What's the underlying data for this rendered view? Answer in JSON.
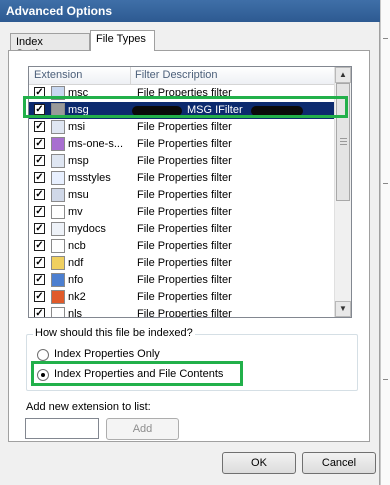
{
  "window": {
    "title": "Advanced Options"
  },
  "tabs": [
    {
      "label": "Index Settings",
      "active": false
    },
    {
      "label": "File Types",
      "active": true
    }
  ],
  "list": {
    "columns": [
      "Extension",
      "Filter Description"
    ],
    "rows": [
      {
        "ext": "msc",
        "desc": "File Properties filter",
        "checked": true,
        "icon": "msc-file-icon"
      },
      {
        "ext": "msg",
        "desc": "MSG IFilter",
        "checked": true,
        "selected": true,
        "icon": "msg-file-icon"
      },
      {
        "ext": "msi",
        "desc": "File Properties filter",
        "checked": true,
        "icon": "msi-file-icon"
      },
      {
        "ext": "ms-one-s...",
        "desc": "File Properties filter",
        "checked": true,
        "icon": "onenote-file-icon"
      },
      {
        "ext": "msp",
        "desc": "File Properties filter",
        "checked": true,
        "icon": "msp-file-icon"
      },
      {
        "ext": "msstyles",
        "desc": "File Properties filter",
        "checked": true,
        "icon": "msstyles-file-icon"
      },
      {
        "ext": "msu",
        "desc": "File Properties filter",
        "checked": true,
        "icon": "msu-file-icon"
      },
      {
        "ext": "mv",
        "desc": "File Properties filter",
        "checked": true,
        "icon": "generic-file-icon"
      },
      {
        "ext": "mydocs",
        "desc": "File Properties filter",
        "checked": true,
        "icon": "mydocs-file-icon"
      },
      {
        "ext": "ncb",
        "desc": "File Properties filter",
        "checked": true,
        "icon": "generic-file-icon"
      },
      {
        "ext": "ndf",
        "desc": "File Properties filter",
        "checked": true,
        "icon": "ndf-file-icon"
      },
      {
        "ext": "nfo",
        "desc": "File Properties filter",
        "checked": true,
        "icon": "nfo-file-icon"
      },
      {
        "ext": "nk2",
        "desc": "File Properties filter",
        "checked": true,
        "icon": "office-file-icon"
      },
      {
        "ext": "nls",
        "desc": "File Properties filter",
        "checked": true,
        "icon": "generic-file-icon"
      }
    ]
  },
  "index_group": {
    "label": "How should this file be indexed?",
    "options": [
      {
        "label": "Index Properties Only",
        "selected": false
      },
      {
        "label": "Index Properties and File Contents",
        "selected": true
      }
    ]
  },
  "add_extension": {
    "label": "Add new extension to list:",
    "value": "",
    "button": "Add"
  },
  "footer": {
    "ok": "OK",
    "cancel": "Cancel"
  },
  "colors": {
    "selection": "#0c2a6e",
    "highlight_border": "#22b04a",
    "titlebar": "#2d5a91"
  }
}
